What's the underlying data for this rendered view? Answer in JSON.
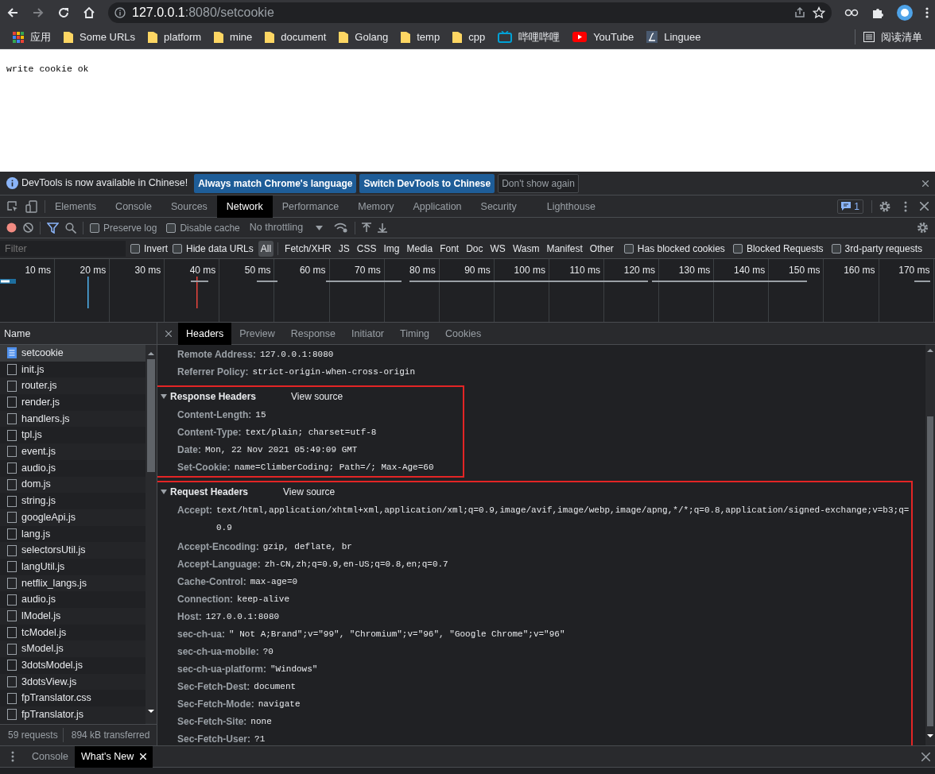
{
  "browser": {
    "url_host": "127.0.0.1",
    "url_rest": ":8080/setcookie"
  },
  "bookmarks": [
    {
      "label": "应用",
      "kind": "apps"
    },
    {
      "label": "Some URLs",
      "kind": "folder"
    },
    {
      "label": "platform",
      "kind": "folder"
    },
    {
      "label": "mine",
      "kind": "folder"
    },
    {
      "label": "document",
      "kind": "folder"
    },
    {
      "label": "Golang",
      "kind": "folder"
    },
    {
      "label": "temp",
      "kind": "folder"
    },
    {
      "label": "cpp",
      "kind": "folder"
    },
    {
      "label": "哔哩哔哩",
      "kind": "tv"
    },
    {
      "label": "YouTube",
      "kind": "video"
    },
    {
      "label": "Linguee",
      "kind": "letter"
    }
  ],
  "reading_list": "阅读清单",
  "page_text": "write cookie ok",
  "infobar": {
    "message": "DevTools is now available in Chinese!",
    "buttons": [
      {
        "label": "Always match Chrome's language",
        "kind": "primary"
      },
      {
        "label": "Switch DevTools to Chinese",
        "kind": "primary"
      },
      {
        "label": "Don't show again",
        "kind": "secondary"
      }
    ]
  },
  "devtools_tabs": [
    {
      "label": "Elements",
      "selected": false
    },
    {
      "label": "Console",
      "selected": false
    },
    {
      "label": "Sources",
      "selected": false
    },
    {
      "label": "Network",
      "selected": true
    },
    {
      "label": "Performance",
      "selected": false
    },
    {
      "label": "Memory",
      "selected": false
    },
    {
      "label": "Application",
      "selected": false
    },
    {
      "label": "Security",
      "selected": false
    },
    {
      "label": "Lighthouse",
      "selected": false
    }
  ],
  "issues_count": "1",
  "toolbar": {
    "recording": true,
    "options": [
      {
        "label": "Preserve log",
        "checked": false
      },
      {
        "label": "Disable cache",
        "checked": false
      }
    ],
    "throttling": "No throttling"
  },
  "filter": {
    "placeholder": "Filter",
    "options": [
      {
        "label": "Invert",
        "checked": false
      },
      {
        "label": "Hide data URLs",
        "checked": false
      }
    ],
    "types": [
      {
        "label": "All",
        "selected": true
      },
      {
        "label": "Fetch/XHR",
        "selected": false
      },
      {
        "label": "JS",
        "selected": false
      },
      {
        "label": "CSS",
        "selected": false
      },
      {
        "label": "Img",
        "selected": false
      },
      {
        "label": "Media",
        "selected": false
      },
      {
        "label": "Font",
        "selected": false
      },
      {
        "label": "Doc",
        "selected": false
      },
      {
        "label": "WS",
        "selected": false
      },
      {
        "label": "Wasm",
        "selected": false
      },
      {
        "label": "Manifest",
        "selected": false
      },
      {
        "label": "Other",
        "selected": false
      }
    ],
    "extra_options": [
      {
        "label": "Has blocked cookies",
        "checked": false
      },
      {
        "label": "Blocked Requests",
        "checked": false
      },
      {
        "label": "3rd-party requests",
        "checked": false
      }
    ]
  },
  "timeline": {
    "ticks": [
      "10 ms",
      "20 ms",
      "30 ms",
      "40 ms",
      "50 ms",
      "60 ms",
      "70 ms",
      "80 ms",
      "90 ms",
      "100 ms",
      "110 ms",
      "120 ms",
      "130 ms",
      "140 ms",
      "150 ms",
      "160 ms",
      "170 ms"
    ]
  },
  "requests": {
    "column": "Name",
    "rows": [
      {
        "name": "setcookie",
        "kind": "document",
        "selected": true
      },
      {
        "name": "init.js",
        "kind": "file",
        "selected": false
      },
      {
        "name": "router.js",
        "kind": "file",
        "selected": false
      },
      {
        "name": "render.js",
        "kind": "file",
        "selected": false
      },
      {
        "name": "handlers.js",
        "kind": "file",
        "selected": false
      },
      {
        "name": "tpl.js",
        "kind": "file",
        "selected": false
      },
      {
        "name": "event.js",
        "kind": "file",
        "selected": false
      },
      {
        "name": "audio.js",
        "kind": "file",
        "selected": false
      },
      {
        "name": "dom.js",
        "kind": "file",
        "selected": false
      },
      {
        "name": "string.js",
        "kind": "file",
        "selected": false
      },
      {
        "name": "googleApi.js",
        "kind": "file",
        "selected": false
      },
      {
        "name": "lang.js",
        "kind": "file",
        "selected": false
      },
      {
        "name": "selectorsUtil.js",
        "kind": "file",
        "selected": false
      },
      {
        "name": "langUtil.js",
        "kind": "file",
        "selected": false
      },
      {
        "name": "netflix_langs.js",
        "kind": "file",
        "selected": false
      },
      {
        "name": "audio.js",
        "kind": "file",
        "selected": false
      },
      {
        "name": "lModel.js",
        "kind": "file",
        "selected": false
      },
      {
        "name": "tcModel.js",
        "kind": "file",
        "selected": false
      },
      {
        "name": "sModel.js",
        "kind": "file",
        "selected": false
      },
      {
        "name": "3dotsModel.js",
        "kind": "file",
        "selected": false
      },
      {
        "name": "3dotsView.js",
        "kind": "file",
        "selected": false
      },
      {
        "name": "fpTranslator.css",
        "kind": "file",
        "selected": false
      },
      {
        "name": "fpTranslator.js",
        "kind": "file",
        "selected": false
      }
    ],
    "summary": [
      "59 requests",
      "894 kB transferred"
    ]
  },
  "details": {
    "tabs": [
      {
        "label": "Headers",
        "selected": true
      },
      {
        "label": "Preview",
        "selected": false
      },
      {
        "label": "Response",
        "selected": false
      },
      {
        "label": "Initiator",
        "selected": false
      },
      {
        "label": "Timing",
        "selected": false
      },
      {
        "label": "Cookies",
        "selected": false
      }
    ],
    "general": [
      {
        "name": "Remote Address:",
        "value": "127.0.0.1:8080"
      },
      {
        "name": "Referrer Policy:",
        "value": "strict-origin-when-cross-origin"
      }
    ],
    "sections": [
      {
        "title": "Response Headers",
        "expanded": true,
        "highlighted": true,
        "view_source": "View source",
        "headers": [
          {
            "name": "Content-Length:",
            "value": "15"
          },
          {
            "name": "Content-Type:",
            "value": "text/plain; charset=utf-8"
          },
          {
            "name": "Date:",
            "value": "Mon, 22 Nov 2021 05:49:09 GMT"
          },
          {
            "name": "Set-Cookie:",
            "value": "name=ClimberCoding; Path=/; Max-Age=60"
          }
        ]
      },
      {
        "title": "Request Headers",
        "expanded": true,
        "highlighted": true,
        "view_source": "View source",
        "headers": [
          {
            "name": "Accept:",
            "value": "text/html,application/xhtml+xml,application/xml;q=0.9,image/avif,image/webp,image/apng,*/*;q=0.8,application/signed-exchange;v=b3;q=0.9"
          },
          {
            "name": "Accept-Encoding:",
            "value": "gzip, deflate, br"
          },
          {
            "name": "Accept-Language:",
            "value": "zh-CN,zh;q=0.9,en-US;q=0.8,en;q=0.7"
          },
          {
            "name": "Cache-Control:",
            "value": "max-age=0"
          },
          {
            "name": "Connection:",
            "value": "keep-alive"
          },
          {
            "name": "Host:",
            "value": "127.0.0.1:8080"
          },
          {
            "name": "sec-ch-ua:",
            "value": "\" Not A;Brand\";v=\"99\", \"Chromium\";v=\"96\", \"Google Chrome\";v=\"96\""
          },
          {
            "name": "sec-ch-ua-mobile:",
            "value": "?0"
          },
          {
            "name": "sec-ch-ua-platform:",
            "value": "\"Windows\""
          },
          {
            "name": "Sec-Fetch-Dest:",
            "value": "document"
          },
          {
            "name": "Sec-Fetch-Mode:",
            "value": "navigate"
          },
          {
            "name": "Sec-Fetch-Site:",
            "value": "none"
          },
          {
            "name": "Sec-Fetch-User:",
            "value": "?1"
          }
        ]
      }
    ]
  },
  "drawer": {
    "tabs": [
      {
        "label": "Console",
        "selected": false,
        "closable": false
      },
      {
        "label": "What's New",
        "selected": true,
        "closable": true
      }
    ]
  }
}
